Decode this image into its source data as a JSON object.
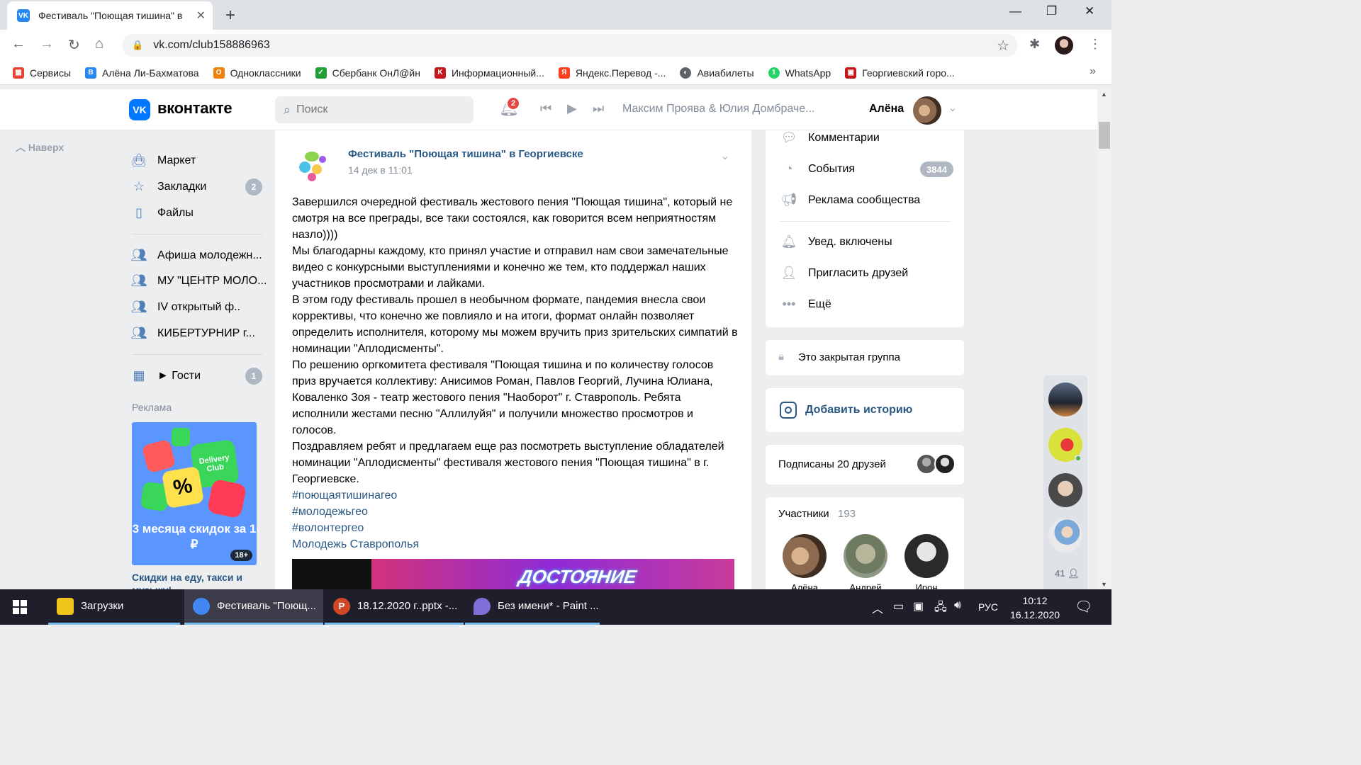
{
  "browser": {
    "tab_title": "Фестиваль \"Поющая тишина\" в",
    "url": "vk.com/club158886963",
    "bookmarks": [
      {
        "label": "Сервисы",
        "color": "#ea4335"
      },
      {
        "label": "Алёна Ли-Бахматова",
        "color": "#2787f5"
      },
      {
        "label": "Одноклассники",
        "color": "#ee8208"
      },
      {
        "label": "Сбербанк ОнЛ@йн",
        "color": "#21a038"
      },
      {
        "label": "Информационный...",
        "color": "#c4161c"
      },
      {
        "label": "Яндекс.Перевод -...",
        "color": "#fc3f1d"
      },
      {
        "label": "Авиабилеты",
        "color": "#5f6368"
      },
      {
        "label": "WhatsApp",
        "color": "#25d366"
      },
      {
        "label": "Георгиевский горо...",
        "color": "#c4161c"
      }
    ]
  },
  "vk": {
    "logo_text": "вконтакте",
    "search_placeholder": "Поиск",
    "notifications_count": "2",
    "now_playing": "Максим Проява & Юлия Домбраче...",
    "user_name": "Алёна"
  },
  "left_nav": {
    "to_top": "Наверх",
    "items": [
      {
        "label": "Маркет",
        "icon": "shopping-bag-icon"
      },
      {
        "label": "Закладки",
        "icon": "star-icon",
        "count": "2"
      },
      {
        "label": "Файлы",
        "icon": "file-icon"
      }
    ],
    "groups": [
      {
        "label": "Афиша молодежн..."
      },
      {
        "label": "МУ \"ЦЕНТР МОЛО..."
      },
      {
        "label": "IV открытый ф.."
      },
      {
        "label": "КИБЕРТУРНИР г..."
      }
    ],
    "guests": {
      "label": "► Гости",
      "count": "1"
    },
    "ad_label": "Реклама",
    "ad_image_brand": "Delivery Club",
    "ad_image_text": "3 месяца скидок за 1 ₽",
    "ad_age": "18+",
    "ad_caption": "Скидки на еду, такси и музыку!"
  },
  "post": {
    "author": "Фестиваль \"Поющая тишина\" в Георгиевске",
    "date": "14 дек в 11:01",
    "paragraphs": [
      "Завершился очередной фестиваль жестового пения \"Поющая тишина\", который не смотря на все преграды, все таки состоялся, как говорится всем неприятностям назло))))",
      "Мы благодарны каждому, кто принял участие и отправил нам свои замечательные видео с конкурсными выступлениями и конечно же тем, кто поддержал наших участников просмотрами и лайками.",
      "В этом году фестиваль прошел в необычном формате, пандемия внесла свои коррективы, что конечно же повлияло и на итоги, формат онлайн позволяет определить исполнителя, которому мы можем вручить приз зрительских симпатий в номинации \"Аплодисменты\".",
      "По решению оргкомитета фестиваля \"Поющая тишина и по количеству голосов приз вручается коллективу: Анисимов Роман, Павлов Георгий, Лучина Юлиана, Коваленко Зоя - театр жестового пения \"Наоборот\" г. Ставрополь. Ребята исполнили жестами песню \"Аллилуйя\" и получили множество просмотров и голосов.",
      "Поздравляем ребят и предлагаем еще раз посмотреть выступление обладателей номинации \"Аплодисменты\" фестиваля жестового пения \"Поющая тишина\" в г. Георгиевске."
    ],
    "tags": [
      "#поющаятишинагео",
      "#молодежьгео",
      "#волонтергео",
      "Молодежь Ставрополья"
    ],
    "video_caption": "ДОСТОЯНИЕ"
  },
  "right": {
    "menu": [
      {
        "label": "Комментарии",
        "icon": "comment-icon"
      },
      {
        "label": "События",
        "icon": "event-icon",
        "count": "3844"
      },
      {
        "label": "Реклама сообщества",
        "icon": "megaphone-icon"
      }
    ],
    "actions": [
      {
        "label": "Увед. включены",
        "icon": "bell-check-icon"
      },
      {
        "label": "Пригласить друзей",
        "icon": "add-user-icon"
      },
      {
        "label": "Ещё",
        "icon": "more-icon"
      }
    ],
    "closed_group": "Это закрытая группа",
    "add_story": "Добавить историю",
    "subscribed": "Подписаны 20 друзей",
    "members_title": "Участники",
    "members_count": "193",
    "members": [
      {
        "name": "Алёна"
      },
      {
        "name": "Андрей"
      },
      {
        "name": "Ирон"
      }
    ],
    "online_friends_count": "41"
  },
  "taskbar": {
    "items": [
      {
        "label": "Загрузки",
        "color": "#f0c419"
      },
      {
        "label": "Фестиваль \"Поющ...",
        "color": "#4285f4"
      },
      {
        "label": "18.12.2020 г..pptx -...",
        "color": "#d24726"
      },
      {
        "label": "Без имени* - Paint ...",
        "color": "#7f6dd9"
      }
    ],
    "lang": "РУС",
    "time": "10:12",
    "date": "16.12.2020"
  },
  "colors": {
    "vk_blue": "#0077ff",
    "link": "#2a5885",
    "badge": "#aeb7c2",
    "chrome_bg": "#dee1e6"
  }
}
